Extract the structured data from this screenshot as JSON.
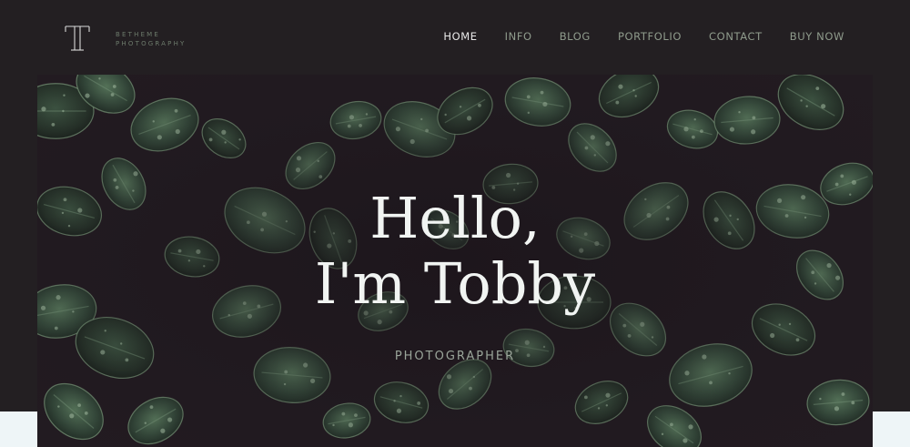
{
  "brand": {
    "line1": "BETHEME",
    "line2": "PHOTOGRAPHY"
  },
  "nav": {
    "items": [
      {
        "label": "HOME",
        "active": true
      },
      {
        "label": "INFO",
        "active": false
      },
      {
        "label": "BLOG",
        "active": false
      },
      {
        "label": "PORTFOLIO",
        "active": false
      },
      {
        "label": "CONTACT",
        "active": false
      },
      {
        "label": "BUY NOW",
        "active": false
      }
    ]
  },
  "hero": {
    "title_line1": "Hello,",
    "title_line2": "I'm Tobby",
    "subtitle": "PHOTOGRAPHER",
    "background": "dark green succulent leaves with water droplets"
  },
  "colors": {
    "header_bg": "#231f22",
    "nav_active": "#e8e8e8",
    "nav_inactive": "#8f9b8c",
    "hero_text": "#f1f4f2",
    "leaf_green": "#3e5a3f",
    "band_light": "#eef5f7"
  }
}
